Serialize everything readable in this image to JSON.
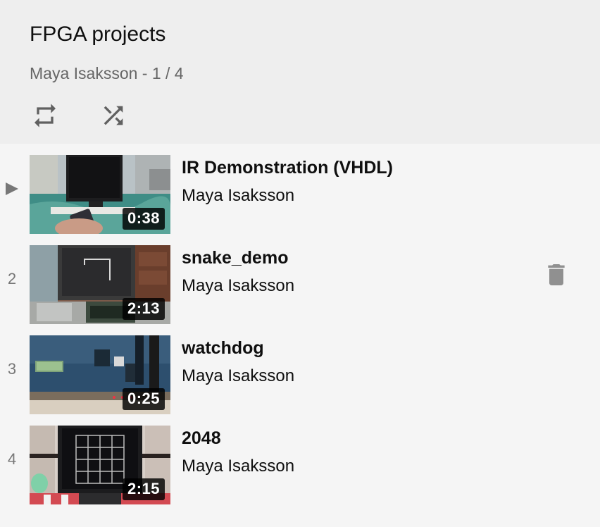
{
  "playlist": {
    "title": "FPGA projects",
    "subtitle": "Maya Isaksson - 1 / 4",
    "controls": {
      "repeat": "repeat-icon",
      "shuffle": "shuffle-icon"
    }
  },
  "videos": [
    {
      "index": "1",
      "current": true,
      "title": "IR Demonstration (VHDL)",
      "author": "Maya Isaksson",
      "duration": "0:38"
    },
    {
      "index": "2",
      "current": false,
      "title": "snake_demo",
      "author": "Maya Isaksson",
      "duration": "2:13",
      "hovered": true
    },
    {
      "index": "3",
      "current": false,
      "title": "watchdog",
      "author": "Maya Isaksson",
      "duration": "0:25"
    },
    {
      "index": "4",
      "current": false,
      "title": "2048",
      "author": "Maya Isaksson",
      "duration": "2:15"
    }
  ],
  "colors": {
    "header_bg": "#eeeeee",
    "list_bg": "#f5f5f5",
    "icon": "#606060",
    "trash": "#909090"
  }
}
